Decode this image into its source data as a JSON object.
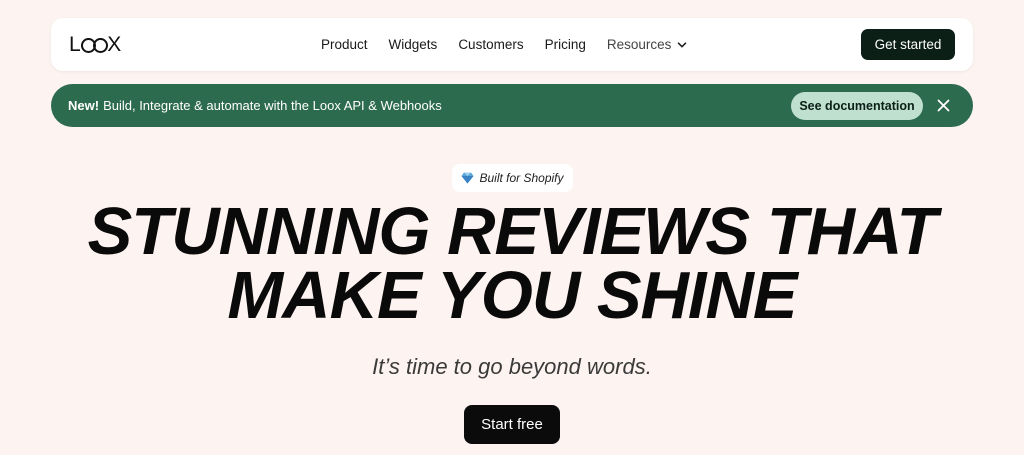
{
  "navbar": {
    "logo_text": "LOOX",
    "links": [
      {
        "label": "Product"
      },
      {
        "label": "Widgets"
      },
      {
        "label": "Customers"
      },
      {
        "label": "Pricing"
      },
      {
        "label": "Resources"
      }
    ],
    "cta_label": "Get started"
  },
  "banner": {
    "new_label": "New!",
    "message": "Build, Integrate & automate with the Loox API & Webhooks",
    "button_label": "See documentation",
    "close_icon": "close-icon"
  },
  "hero": {
    "badge_icon": "diamond-icon",
    "badge_label": "Built for Shopify",
    "headline_line1": "STUNNING REVIEWS THAT",
    "headline_line2": "MAKE YOU SHINE",
    "subheadline": "It’s time to go beyond words.",
    "cta_label": "Start free"
  },
  "colors": {
    "page_bg": "#fdf3f0",
    "banner_green": "#2d6b4e",
    "doc_button": "#bfe0cf",
    "dark_button": "#0c1f17"
  }
}
